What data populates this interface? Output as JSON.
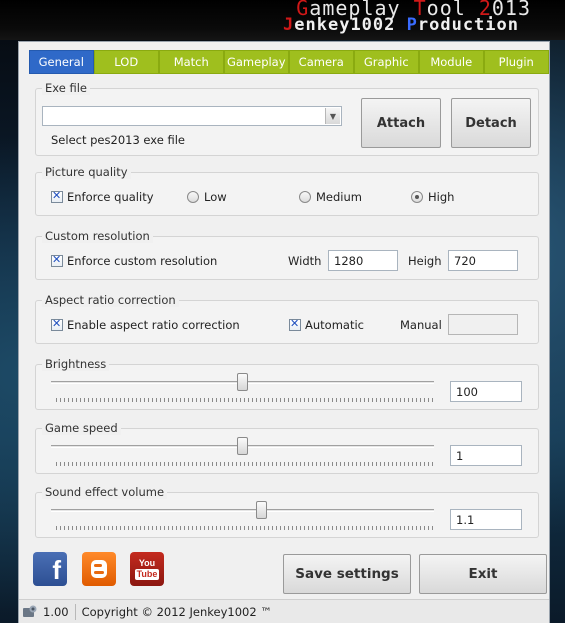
{
  "banner": {
    "title_first": "G",
    "title_rest": "ameplay ",
    "title_t": "T",
    "title_ool": "ool ",
    "title_2": "2",
    "title_013": "013",
    "sub_j": "J",
    "sub_rest": "enkey1002 ",
    "sub_p": "P",
    "sub_roduction": "roduction"
  },
  "tabs": [
    {
      "label": "General",
      "active": true
    },
    {
      "label": "LOD"
    },
    {
      "label": "Match"
    },
    {
      "label": "Gameplay"
    },
    {
      "label": "Camera"
    },
    {
      "label": "Graphic"
    },
    {
      "label": "Module"
    },
    {
      "label": "Plugin"
    }
  ],
  "exe": {
    "title": "Exe file",
    "value": "",
    "hint": "Select pes2013 exe file",
    "attach_label": "Attach",
    "detach_label": "Detach"
  },
  "quality": {
    "title": "Picture quality",
    "enforce_label": "Enforce quality",
    "enforce_checked": true,
    "options": [
      "Low",
      "Medium",
      "High"
    ],
    "selected": "High"
  },
  "resolution": {
    "title": "Custom resolution",
    "enforce_label": "Enforce custom resolution",
    "enforce_checked": true,
    "width_label": "Width",
    "width_value": "1280",
    "height_label": "Heigh",
    "height_value": "720"
  },
  "aspect": {
    "title": "Aspect ratio correction",
    "enable_label": "Enable aspect ratio correction",
    "enable_checked": true,
    "auto_label": "Automatic",
    "auto_checked": true,
    "manual_label": "Manual",
    "manual_value": ""
  },
  "brightness": {
    "title": "Brightness",
    "value": "100",
    "level": 0.5
  },
  "game_speed": {
    "title": "Game speed",
    "value": "1",
    "level": 0.5
  },
  "sound": {
    "title": "Sound effect volume",
    "value": "1.1",
    "level": 0.55
  },
  "footer": {
    "save_label": "Save settings",
    "exit_label": "Exit"
  },
  "social": {
    "facebook_icon": "facebook-icon",
    "blogger_icon": "blogger-icon",
    "youtube_icon": "youtube-icon",
    "youtube_you": "You",
    "youtube_tube": "Tube"
  },
  "status": {
    "version": "1.00",
    "copyright": "Copyright © 2012 Jenkey1002 ™"
  },
  "colors": {
    "tab_active": "#2f69c8",
    "tab_inactive": "#9fbf1e"
  }
}
